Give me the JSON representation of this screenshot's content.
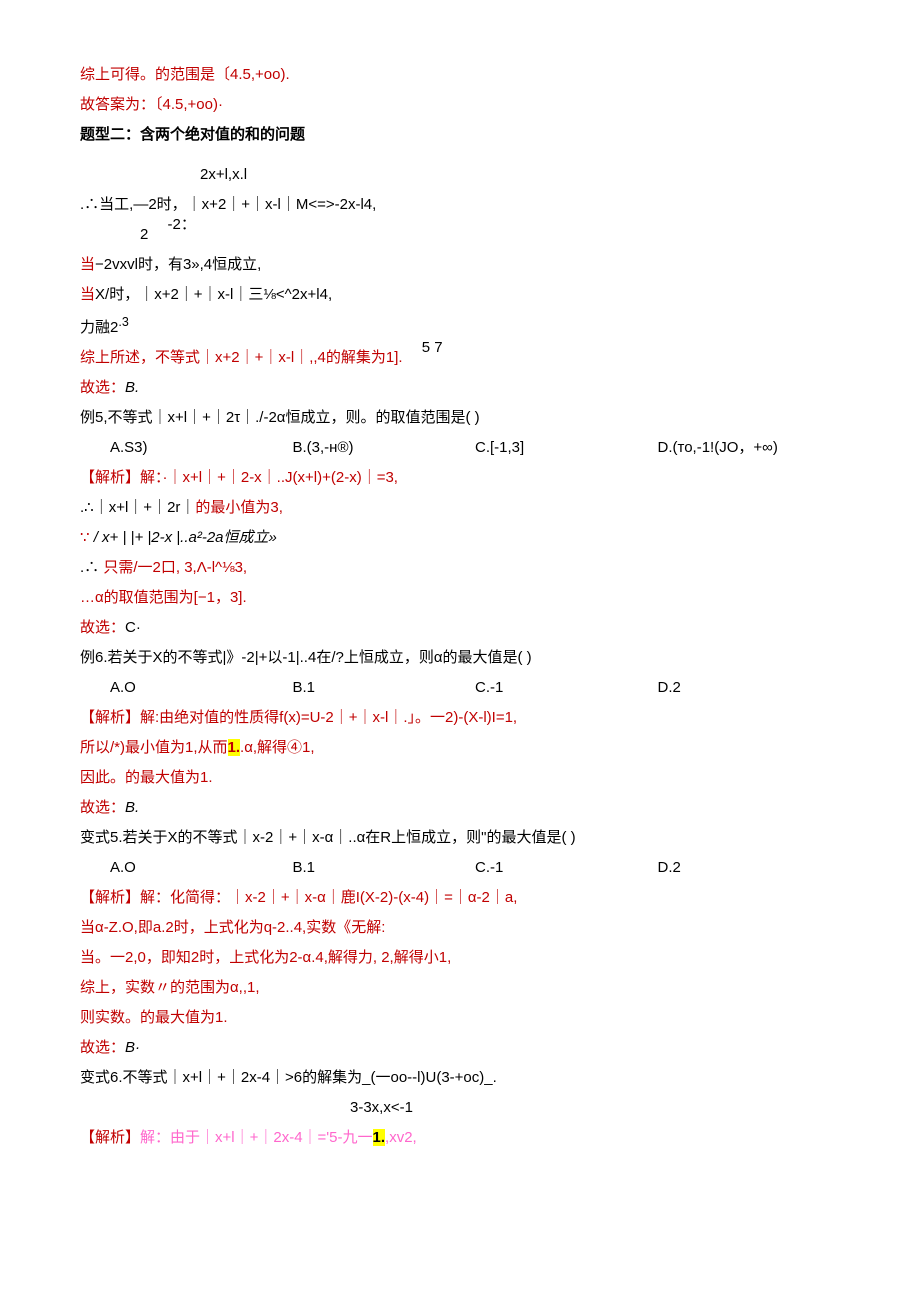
{
  "lines": {
    "l1": "综上可得。的范围是〔4.5,+oo).",
    "l2": "故答案为：〔4.5,+oo)·",
    "l3": "题型二：含两个绝对值的和的问题",
    "l4": "2x+l,x.l",
    "l5_a": ".∴当工,—2时，｜x+2｜+｜x-l｜M<=>-2x-l4,",
    "l6_a": "2",
    "l6_b": "-2：",
    "l7_a": "当",
    "l7_b": "−2vxvl时，有3»,4恒成立,",
    "l8_a": "当",
    "l8_b": "X/时，｜x+2｜+｜x-l｜三⅛<^2x+l4,",
    "l9_a": "力融2",
    "l9_b": ".3",
    "l10_a": "综上所述，不等式｜x+2｜+｜x-l｜,,4的解集为1].",
    "l10_b": "5    7",
    "l11_a": "故选：",
    "l11_b": "B.",
    "l12": "例5,不等式｜x+l｜+｜2τ｜./-2α恒成立，则。的取值范围是(             )",
    "opt1_a": "A.S3)",
    "opt1_b": "B.(3,-н®)",
    "opt1_c": "C.[-1,3]",
    "opt1_d": "D.(то,-1!(JO，+∞)",
    "l13": "【解析】解：·｜x+l｜+｜2-x｜..J(x+l)+(2-x)｜=3,",
    "l14_a": ".∴｜x+l｜+｜2r｜",
    "l14_b": "的最小值为3,",
    "l15_a": "∵ ",
    "l15_b": "/ x+ | |+ |2-x |..a²-2a恒成立»",
    "l16_a": ".∴ ",
    "l16_b": "只需/一2口, 3,Λ-l^⅛3,",
    "l17": "…α的取值范围为[−1，3].",
    "l18_a": "故选：",
    "l18_b": "C·",
    "l19": "例6.若关于X的不等式|》-2|+以-1|..4在/?上恒成立，则α的最大值是(                 )",
    "opt2_a": "A.O",
    "opt2_b": "B.1",
    "opt2_c": "C.-1",
    "opt2_d": "D.2",
    "l20": "【解析】解:由绝对值的性质得f(x)=U-2｜+｜x-l｜.」。一2)-(X-l)I=1,",
    "l21_a": "所以/*)",
    "l21_b": "最小值为1,从而",
    "l21_c": "1.",
    "l21_d": ".α,解得④1,",
    "l22": "因此。的最大值为1.",
    "l23_a": "故选：",
    "l23_b": "B.",
    "l24": "变式5.若关于X的不等式｜x-2｜+｜x-α｜..α在R上恒成立，则\"的最大值是(           )",
    "opt3_a": "A.O",
    "opt3_b": "B.1",
    "opt3_c": "C.-1",
    "opt3_d": "D.2",
    "l25": "【解析】解：化简得：｜x-2｜+｜x-α｜鹿I(X-2)-(x-4)｜=｜α-2｜a,",
    "l26_a": "当",
    "l26_b": "α-Z.O,即a.2时，上式化为q-2..4,实数《无解:",
    "l27": "当。一2,0，即知2时，上式化为2-α.4,解得力, 2,解得小1,",
    "l28": "综上，实数〃的范围为α,,1,",
    "l29": "则实数。的最大值为1.",
    "l30_a": "故选：",
    "l30_b": "B·",
    "l31": "变式6.不等式｜x+l｜+｜2x-4｜>6的解集为_(一oo--l)U(3-+oc)_.",
    "l32": "3-3x,x<-1",
    "l33_a": "【解析】",
    "l33_b": "解：由于｜x+l｜+｜2x-4｜='5-九一",
    "l33_c": "1.",
    "l33_d": ",xv2,"
  }
}
